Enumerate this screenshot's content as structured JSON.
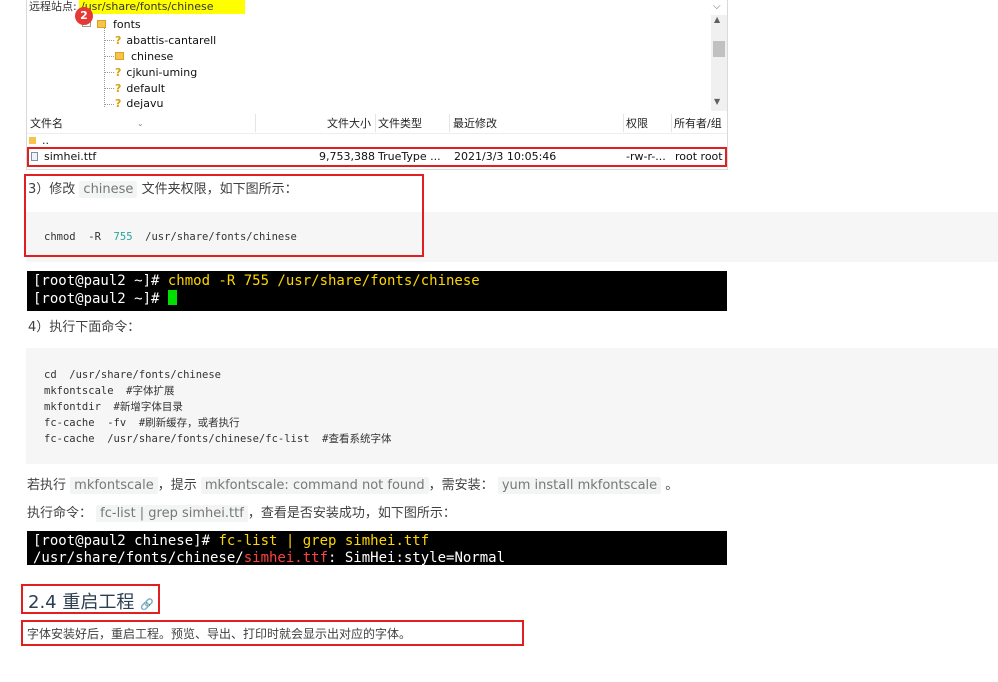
{
  "file_manager": {
    "site_label": "远程站点:",
    "site_path": "/usr/share/fonts/chinese",
    "tree": [
      {
        "name": "fonts",
        "icon": "folder-icon"
      },
      {
        "name": "abattis-cantarell",
        "icon": "question-icon"
      },
      {
        "name": "chinese",
        "icon": "folder-icon"
      },
      {
        "name": "cjkuni-uming",
        "icon": "question-icon"
      },
      {
        "name": "default",
        "icon": "question-icon"
      },
      {
        "name": "dejavu",
        "icon": "question-icon"
      }
    ],
    "columns": {
      "name": "文件名",
      "size": "文件大小",
      "type": "文件类型",
      "modified": "最近修改",
      "perms": "权限",
      "owner": "所有者/组"
    },
    "badge": "2",
    "parent_dir": "..",
    "file": {
      "name": "simhei.ttf",
      "size": "9,753,388",
      "type": "TrueType ...",
      "modified": "2021/3/3 10:05:46",
      "perms": "-rw-r-...",
      "owner": "root root"
    }
  },
  "step3": {
    "prefix": "3）修改",
    "code": "chinese",
    "suffix": "文件夹权限，如下图所示：",
    "command": "chmod  -R  755  /usr/share/fonts/chinese",
    "cmd_prefix": "chmod  -R  ",
    "cmd_num": "755",
    "cmd_suffix": "  /usr/share/fonts/chinese"
  },
  "terminal1": {
    "prompt1": "[root@paul2 ~]# ",
    "cmd1": "chmod -R 755 /usr/share/fonts/chinese",
    "prompt2": "[root@paul2 ~]# "
  },
  "step4": {
    "title": "4）执行下面命令：",
    "lines": [
      "cd  /usr/share/fonts/chinese",
      "mkfontscale  #字体扩展",
      "mkfontdir  #新增字体目录",
      "fc-cache  -fv  #刷新缓存，或者执行",
      "fc-cache  /usr/share/fonts/chinese/fc-list  #查看系统字体"
    ]
  },
  "note1": {
    "t1": "若执行",
    "c1": "mkfontscale",
    "t2": "，提示",
    "c2": "mkfontscale: command not found",
    "t3": "，需安装：",
    "c3": "yum install mkfontscale",
    "t4": "。"
  },
  "note2": {
    "t1": "执行命令：",
    "c1": "fc-list | grep simhei.ttf",
    "t2": "，查看是否安装成功，如下图所示："
  },
  "terminal2": {
    "prompt": "[root@paul2 chinese]# ",
    "cmd": "fc-list | grep simhei.ttf",
    "out_path": "/usr/share/fonts/chinese/",
    "out_file": "simhei.ttf",
    "out_rest": ": SimHei:style=Normal"
  },
  "section": {
    "heading": "2.4 重启工程",
    "body": "字体安装好后，重启工程。预览、导出、打印时就会显示出对应的字体。"
  }
}
